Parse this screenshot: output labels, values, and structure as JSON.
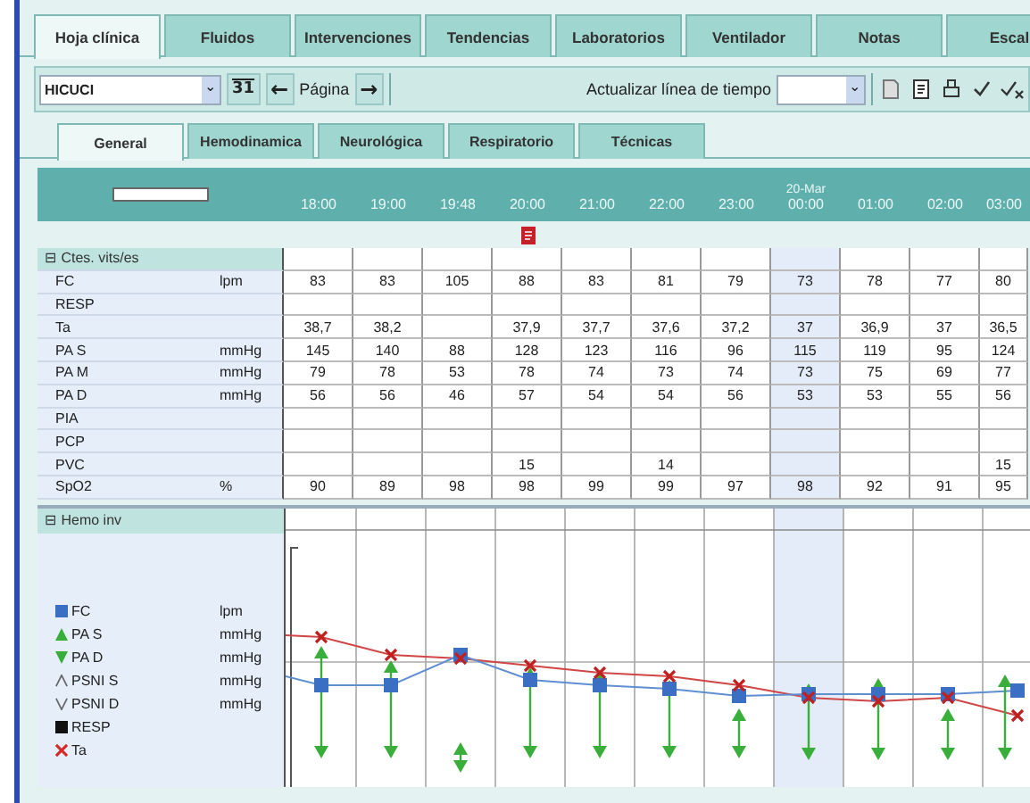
{
  "tabs": [
    {
      "label": "Hoja clínica",
      "selected": true
    },
    {
      "label": "Fluidos",
      "selected": false
    },
    {
      "label": "Intervenciones",
      "selected": false
    },
    {
      "label": "Tendencias",
      "selected": false
    },
    {
      "label": "Laboratorios",
      "selected": false
    },
    {
      "label": "Ventilador",
      "selected": false
    },
    {
      "label": "Notas",
      "selected": false
    },
    {
      "label": "Escal",
      "selected": false
    }
  ],
  "toolbar": {
    "unit_select": {
      "value": "HICUCI",
      "arrow": "⌄"
    },
    "calendar": "31",
    "prev": "←",
    "page_label": "Página",
    "next": "→",
    "timeline_label": "Actualizar línea de tiempo",
    "timeline_select": {
      "arrow": "⌄"
    }
  },
  "subtabs": [
    {
      "label": "General",
      "selected": true
    },
    {
      "label": "Hemodinamica",
      "selected": false
    },
    {
      "label": "Neurológica",
      "selected": false
    },
    {
      "label": "Respiratorio",
      "selected": false
    },
    {
      "label": "Técnicas",
      "selected": false
    }
  ],
  "timeline": [
    {
      "time": "18:00",
      "highlighted": false,
      "flag": false
    },
    {
      "time": "19:00",
      "highlighted": false,
      "flag": false
    },
    {
      "time": "19:48",
      "highlighted": false,
      "flag": false
    },
    {
      "time": "20:00",
      "highlighted": false,
      "flag": true
    },
    {
      "time": "21:00",
      "highlighted": false,
      "flag": false
    },
    {
      "time": "22:00",
      "highlighted": false,
      "flag": false
    },
    {
      "time": "23:00",
      "highlighted": false,
      "flag": false
    },
    {
      "time": "00:00",
      "date": "20-Mar",
      "highlighted": true,
      "flag": false
    },
    {
      "time": "01:00",
      "highlighted": false,
      "flag": false
    },
    {
      "time": "02:00",
      "highlighted": false,
      "flag": false
    },
    {
      "time": "03:00",
      "highlighted": false,
      "flag": false
    }
  ],
  "vitals": {
    "title": "Ctes. vits/es",
    "expander": "⊟",
    "rows": [
      {
        "name": "FC",
        "unit": "lpm",
        "values": {
          "0": "83",
          "1": "83",
          "2": "105",
          "3": "88",
          "4": "83",
          "5": "81",
          "6": "79",
          "7": "73",
          "8": "78",
          "9": "77",
          "10": "80"
        }
      },
      {
        "name": "RESP"
      },
      {
        "name": "Ta",
        "values": {
          "0": "38,7",
          "1": "38,2",
          "3": "37,9",
          "4": "37,7",
          "5": "37,6",
          "6": "37,2",
          "7": "37",
          "8": "36,9",
          "9": "37",
          "10": "36,5"
        }
      },
      {
        "name": "PA S",
        "unit": "mmHg",
        "values": {
          "0": "145",
          "1": "140",
          "2": "88",
          "3": "128",
          "4": "123",
          "5": "116",
          "6": "96",
          "7": "115",
          "8": "119",
          "9": "95",
          "10": "124"
        }
      },
      {
        "name": "PA M",
        "unit": "mmHg",
        "values": {
          "0": "79",
          "1": "78",
          "2": "53",
          "3": "78",
          "4": "74",
          "5": "73",
          "6": "74",
          "7": "73",
          "8": "75",
          "9": "69",
          "10": "77"
        }
      },
      {
        "name": "PA D",
        "unit": "mmHg",
        "values": {
          "0": "56",
          "1": "56",
          "2": "46",
          "3": "57",
          "4": "54",
          "5": "54",
          "6": "56",
          "7": "53",
          "8": "53",
          "9": "55",
          "10": "56"
        }
      },
      {
        "name": "PIA"
      },
      {
        "name": "PCP"
      },
      {
        "name": "PVC",
        "values": {
          "3": "15",
          "5": "14",
          "10": "15"
        }
      },
      {
        "name": "SpO2",
        "unit": "%",
        "values": {
          "0": "90",
          "1": "89",
          "2": "98",
          "3": "98",
          "4": "99",
          "5": "99",
          "6": "97",
          "7": "98",
          "8": "92",
          "9": "91",
          "10": "95"
        }
      }
    ]
  },
  "hemo": {
    "title": "Hemo inv",
    "expander": "⊟",
    "legend": [
      {
        "kind": "square",
        "color": "#3a6fc4",
        "name": "FC",
        "unit": "lpm"
      },
      {
        "kind": "up",
        "color": "#3aae3a",
        "name": "PA S",
        "unit": "mmHg"
      },
      {
        "kind": "down",
        "color": "#3aae3a",
        "name": "PA D",
        "unit": "mmHg"
      },
      {
        "kind": "open-up",
        "color": "#666666",
        "name": "PSNI S",
        "unit": "mmHg"
      },
      {
        "kind": "open-down",
        "color": "#666666",
        "name": "PSNI D",
        "unit": "mmHg"
      },
      {
        "kind": "square",
        "color": "#111111",
        "name": "RESP"
      },
      {
        "kind": "cross",
        "color": "#d42a2a",
        "name": "Ta"
      }
    ]
  }
}
